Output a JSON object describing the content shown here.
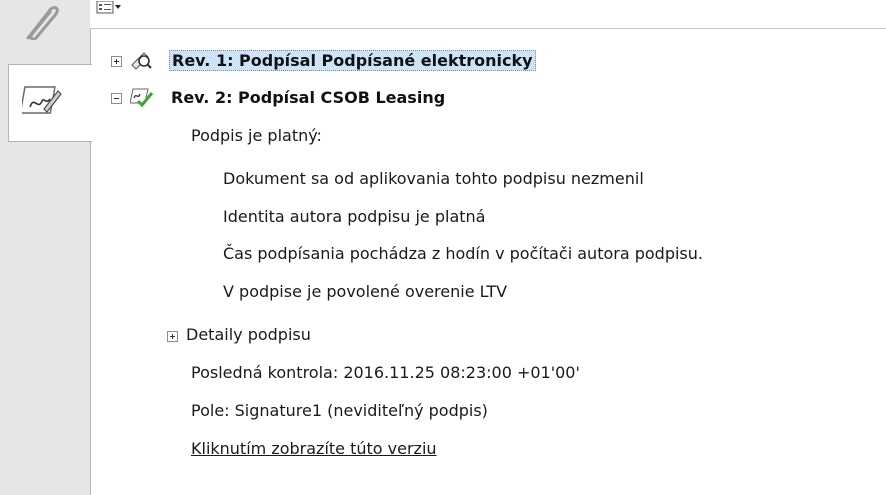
{
  "icons": {
    "attachments": "paperclip-icon",
    "signatures": "signature-pen-icon",
    "options": "options-menu-icon",
    "rev1": "magnifier-signature-icon",
    "rev2": "valid-signature-icon"
  },
  "colors": {
    "selection": "#cfe3f7",
    "sidebar_bg": "#e6e6e6",
    "valid_green": "#3aa635"
  },
  "tree": {
    "rev1": {
      "title": "Rev. 1: Podpísal Podpísané elektronicky"
    },
    "rev2": {
      "title": "Rev. 2: Podpísal CSOB Leasing",
      "status": "Podpis je platný:",
      "details_lines": [
        "Dokument sa od aplikovania tohto podpisu nezmenil",
        "Identita autora podpisu je platná",
        "Čas podpísania pochádza z hodín v počítači autora podpisu.",
        "V podpise je povolené overenie LTV"
      ],
      "signature_details": "Detaily podpisu",
      "last_check": "Posledná kontrola: 2016.11.25 08:23:00 +01'00'",
      "field": "Pole: Signature1 (neviditeľný podpis)",
      "view_version_link": "Kliknutím zobrazíte túto verziu"
    }
  }
}
